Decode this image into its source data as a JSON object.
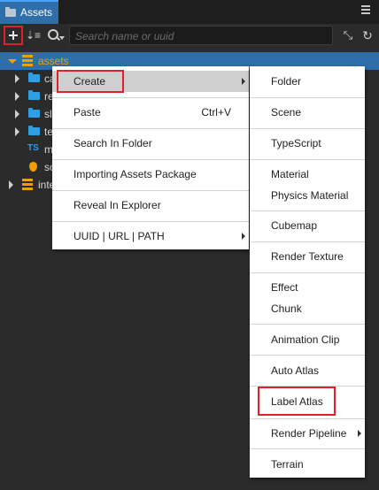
{
  "panel": {
    "tab_title": "Assets"
  },
  "toolbar": {
    "search_placeholder": "Search name or uuid"
  },
  "tree": {
    "root_label": "assets",
    "children": [
      "ca",
      "re",
      "sl",
      "te",
      "m",
      "sc"
    ],
    "internal_label": "inte"
  },
  "context_menu": {
    "create": "Create",
    "paste": "Paste",
    "paste_shortcut": "Ctrl+V",
    "search_in_folder": "Search In Folder",
    "importing_assets_package": "Importing Assets Package",
    "reveal_in_explorer": "Reveal In Explorer",
    "uuid_url_path": "UUID | URL | PATH"
  },
  "create_submenu": {
    "folder": "Folder",
    "scene": "Scene",
    "typescript": "TypeScript",
    "material": "Material",
    "physics_material": "Physics Material",
    "cubemap": "Cubemap",
    "render_texture": "Render Texture",
    "effect": "Effect",
    "chunk": "Chunk",
    "animation_clip": "Animation Clip",
    "auto_atlas": "Auto Atlas",
    "label_atlas": "Label Atlas",
    "render_pipeline": "Render Pipeline",
    "terrain": "Terrain"
  },
  "colors": {
    "accent": "#2f6ea8",
    "highlight_box": "#e0202a",
    "folder": "#2f9ee3",
    "asset_db": "#f0a000"
  }
}
